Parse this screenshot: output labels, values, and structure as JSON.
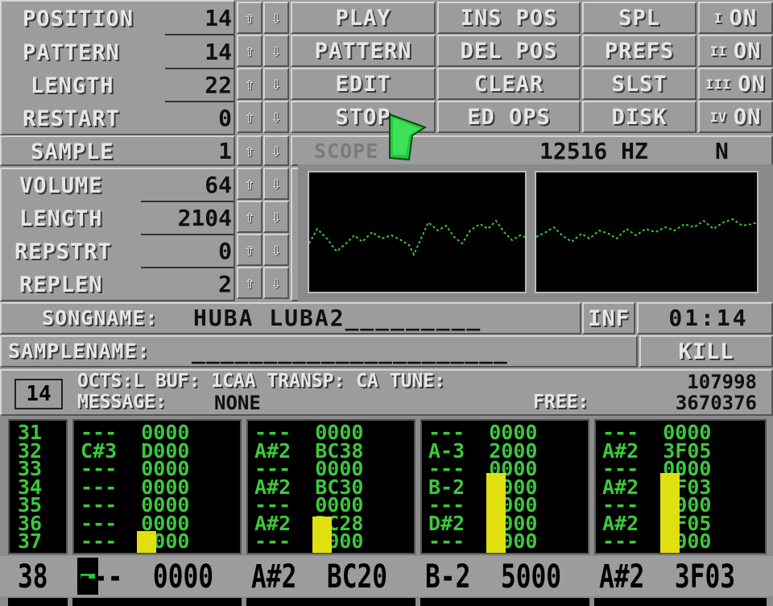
{
  "song_controls": {
    "rows": [
      {
        "label": "POSITION",
        "value": "14"
      },
      {
        "label": "PATTERN",
        "value": "14"
      },
      {
        "label": "LENGTH",
        "value": "22"
      },
      {
        "label": "RESTART",
        "value": "0"
      }
    ],
    "up_arrow": "⇧",
    "down_arrow": "⇩"
  },
  "buttons": {
    "play": "PLAY",
    "pattern": "PATTERN",
    "edit": "EDIT",
    "stop": "STOP",
    "ins_pos": "INS POS",
    "del_pos": "DEL POS",
    "clear": "CLEAR",
    "ed_ops": "ED OPS",
    "spl": "SPL",
    "prefs": "PREFS",
    "slst": "SLST",
    "disk": "DISK"
  },
  "channels": [
    {
      "num": "I",
      "state": "ON"
    },
    {
      "num": "II",
      "state": "ON"
    },
    {
      "num": "III",
      "state": "ON"
    },
    {
      "num": "IV",
      "state": "ON"
    }
  ],
  "sample_controls": {
    "sample": {
      "label": "SAMPLE",
      "value": "1"
    },
    "rows": [
      {
        "label": "VOLUME",
        "value": "64"
      },
      {
        "label": "LENGTH",
        "value": "2104"
      },
      {
        "label": "REPSTRT",
        "value": "0"
      },
      {
        "label": "REPLEN",
        "value": "2"
      }
    ]
  },
  "scope": {
    "label": "SCOPE",
    "freq": "12516 HZ",
    "mode": "N",
    "trace_color": "#3cc83c"
  },
  "songname": {
    "label": "SONGNAME:",
    "value": "HUBA LUBA2_________"
  },
  "inf_button": "INF",
  "time": "01:14",
  "samplename": {
    "label": "SAMPLENAME:",
    "value": "______________________"
  },
  "kill_button": "KILL",
  "status": {
    "pattern_num": "14",
    "line1": "OCTS:L  BUF: 1CAA TRANSP: CA TUNE:",
    "tune_value": "107998",
    "line2_label": "MESSAGE:",
    "line2_value": "NONE",
    "free_label": "FREE:",
    "free_value": "3670376"
  },
  "pattern": {
    "row_numbers": [
      "31",
      "32",
      "33",
      "34",
      "35",
      "36",
      "37"
    ],
    "tracks": [
      [
        "---  0000",
        "C#3  D000",
        "---  0000",
        "---  0000",
        "---  0000",
        "---  0000",
        "---  0000"
      ],
      [
        "---  0000",
        "A#2  BC38",
        "---  0000",
        "A#2  BC30",
        "---  0000",
        "A#2  BC28",
        "---  0000"
      ],
      [
        "---  0000",
        "A-3  2000",
        "---  0000",
        "B-2  5000",
        "---  0000",
        "D#2  1000",
        "---  0000"
      ],
      [
        "---  0000",
        "A#2  3F05",
        "---  0000",
        "A#2  3F03",
        "---  0000",
        "A#2  3F05",
        "---  0000"
      ]
    ],
    "vu_levels": [
      0.17,
      0.28,
      0.62,
      0.62
    ],
    "vu_color": "#e0e010",
    "current_row": {
      "num": "38",
      "tracks": [
        "---  0000",
        "A#2  BC20",
        "B-2  5000",
        "A#2  3F03"
      ]
    }
  },
  "colors": {
    "bg": "#9c9c9c",
    "pattern_text": "#3cc83c",
    "cursor": "#22c83c"
  }
}
